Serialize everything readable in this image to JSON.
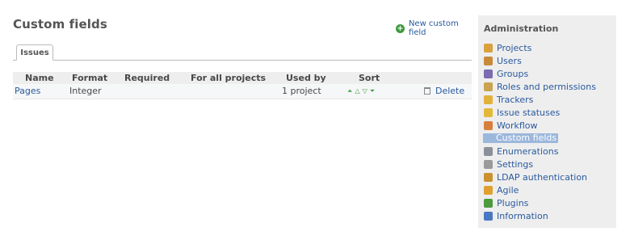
{
  "main": {
    "title": "Custom fields",
    "new_field_label": "New custom field",
    "tabs": [
      {
        "label": "Issues"
      }
    ],
    "table": {
      "columns": [
        "Name",
        "Format",
        "Required",
        "For all projects",
        "Used by",
        "Sort"
      ],
      "rows": [
        {
          "name": "Pages",
          "format": "Integer",
          "required": "",
          "for_all_projects": "",
          "used_by": "1 project",
          "sort_icons": [
            "move-top-icon",
            "move-up-icon",
            "move-down-icon",
            "move-bottom-icon"
          ],
          "delete_label": "Delete"
        }
      ]
    }
  },
  "sidebar": {
    "title": "Administration",
    "items": [
      {
        "label": "Projects",
        "icon": "projects-icon",
        "color": "#d9a23c"
      },
      {
        "label": "Users",
        "icon": "users-icon",
        "color": "#c88a3a"
      },
      {
        "label": "Groups",
        "icon": "groups-icon",
        "color": "#7a6bb2"
      },
      {
        "label": "Roles and permissions",
        "icon": "roles-icon",
        "color": "#c9a34f"
      },
      {
        "label": "Trackers",
        "icon": "trackers-icon",
        "color": "#e1b13a"
      },
      {
        "label": "Issue statuses",
        "icon": "issue-statuses-icon",
        "color": "#e3b83a"
      },
      {
        "label": "Workflow",
        "icon": "workflow-icon",
        "color": "#d77f3b"
      },
      {
        "label": "Custom fields",
        "icon": "custom-fields-icon",
        "selected": true
      },
      {
        "label": "Enumerations",
        "icon": "enumerations-icon",
        "color": "#8a8f99"
      },
      {
        "label": "Settings",
        "icon": "settings-icon",
        "color": "#9a9a9a"
      },
      {
        "label": "LDAP authentication",
        "icon": "ldap-icon",
        "color": "#c9922f"
      },
      {
        "label": "Agile",
        "icon": "agile-icon",
        "color": "#e0a030"
      },
      {
        "label": "Plugins",
        "icon": "plugins-icon",
        "color": "#4c9b3e"
      },
      {
        "label": "Information",
        "icon": "information-icon",
        "color": "#4a78c2"
      }
    ]
  }
}
